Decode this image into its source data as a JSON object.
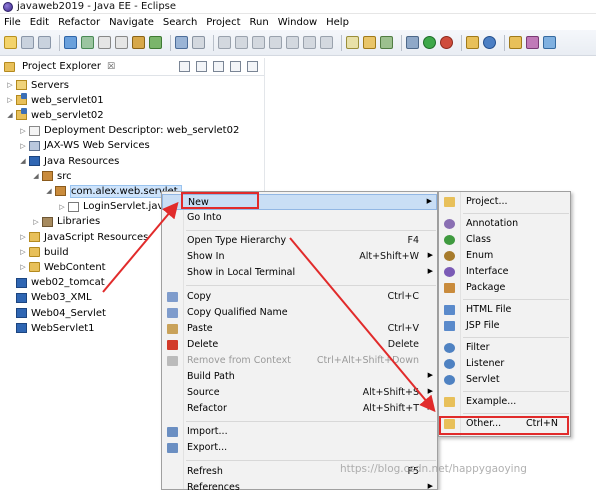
{
  "window": {
    "title": "javaweb2019 - Java EE - Eclipse"
  },
  "menubar": [
    "File",
    "Edit",
    "Refactor",
    "Navigate",
    "Search",
    "Project",
    "Run",
    "Window",
    "Help"
  ],
  "explorer": {
    "tab_label": "Project Explorer",
    "tab_close": "☒",
    "tree": [
      {
        "label": "Servers",
        "depth": 0,
        "expander": "▷",
        "icon": "servers-icon"
      },
      {
        "label": "web_servlet01",
        "depth": 0,
        "expander": "▷",
        "icon": "project-icon"
      },
      {
        "label": "web_servlet02",
        "depth": 0,
        "expander": "◢",
        "icon": "project-icon"
      },
      {
        "label": "Deployment Descriptor: web_servlet02",
        "depth": 1,
        "expander": "▷",
        "icon": "deployment-descriptor-icon"
      },
      {
        "label": "JAX-WS Web Services",
        "depth": 1,
        "expander": "▷",
        "icon": "web-services-icon"
      },
      {
        "label": "Java Resources",
        "depth": 1,
        "expander": "◢",
        "icon": "java-resources-icon"
      },
      {
        "label": "src",
        "depth": 2,
        "expander": "◢",
        "icon": "source-folder-icon"
      },
      {
        "label": "com.alex.web.servlet",
        "depth": 3,
        "expander": "◢",
        "icon": "package-icon",
        "selected": true
      },
      {
        "label": "LoginServlet.java",
        "depth": 4,
        "expander": "▷",
        "icon": "java-file-icon"
      },
      {
        "label": "Libraries",
        "depth": 2,
        "expander": "▷",
        "icon": "library-icon"
      },
      {
        "label": "JavaScript Resources",
        "depth": 1,
        "expander": "▷",
        "icon": "javascript-resources-icon"
      },
      {
        "label": "build",
        "depth": 1,
        "expander": "▷",
        "icon": "folder-icon"
      },
      {
        "label": "WebContent",
        "depth": 1,
        "expander": "▷",
        "icon": "folder-icon"
      },
      {
        "label": "web02_tomcat",
        "depth": 0,
        "expander": "",
        "icon": "closed-project-icon"
      },
      {
        "label": "Web03_XML",
        "depth": 0,
        "expander": "",
        "icon": "closed-project-icon"
      },
      {
        "label": "Web04_Servlet",
        "depth": 0,
        "expander": "",
        "icon": "closed-project-icon"
      },
      {
        "label": "WebServlet1",
        "depth": 0,
        "expander": "",
        "icon": "closed-project-icon"
      }
    ]
  },
  "context_menu": {
    "items": [
      {
        "label": "New",
        "shortcut": "",
        "submenu": true,
        "icon": "",
        "highlighted": true
      },
      {
        "label": "Go Into",
        "shortcut": "",
        "icon": ""
      },
      {
        "sep": true
      },
      {
        "label": "Open Type Hierarchy",
        "shortcut": "F4",
        "icon": ""
      },
      {
        "label": "Show In",
        "shortcut": "Alt+Shift+W",
        "submenu": true,
        "icon": ""
      },
      {
        "label": "Show in Local Terminal",
        "shortcut": "",
        "submenu": true,
        "icon": ""
      },
      {
        "sep": true
      },
      {
        "label": "Copy",
        "shortcut": "Ctrl+C",
        "icon": "copy-icon"
      },
      {
        "label": "Copy Qualified Name",
        "shortcut": "",
        "icon": "copy-qualified-name-icon"
      },
      {
        "label": "Paste",
        "shortcut": "Ctrl+V",
        "icon": "paste-icon"
      },
      {
        "label": "Delete",
        "shortcut": "Delete",
        "icon": "delete-icon"
      },
      {
        "label": "Remove from Context",
        "shortcut": "Ctrl+Alt+Shift+Down",
        "icon": "remove-from-context-icon",
        "disabled": true
      },
      {
        "label": "Build Path",
        "shortcut": "",
        "submenu": true,
        "icon": ""
      },
      {
        "label": "Source",
        "shortcut": "Alt+Shift+S",
        "submenu": true,
        "icon": ""
      },
      {
        "label": "Refactor",
        "shortcut": "Alt+Shift+T",
        "submenu": true,
        "icon": ""
      },
      {
        "sep": true
      },
      {
        "label": "Import...",
        "shortcut": "",
        "icon": "import-icon"
      },
      {
        "label": "Export...",
        "shortcut": "",
        "icon": "export-icon"
      },
      {
        "sep": true
      },
      {
        "label": "Refresh",
        "shortcut": "F5",
        "icon": ""
      },
      {
        "label": "References",
        "shortcut": "",
        "submenu": true,
        "icon": ""
      }
    ]
  },
  "new_submenu": {
    "items": [
      {
        "label": "Project...",
        "shortcut": "",
        "icon": "new-project-icon"
      },
      {
        "sep": true
      },
      {
        "label": "Annotation",
        "shortcut": "",
        "icon": "annotation-icon"
      },
      {
        "label": "Class",
        "shortcut": "",
        "icon": "class-icon"
      },
      {
        "label": "Enum",
        "shortcut": "",
        "icon": "enum-icon"
      },
      {
        "label": "Interface",
        "shortcut": "",
        "icon": "interface-icon"
      },
      {
        "label": "Package",
        "shortcut": "",
        "icon": "package-icon"
      },
      {
        "sep": true
      },
      {
        "label": "HTML File",
        "shortcut": "",
        "icon": "html-file-icon"
      },
      {
        "label": "JSP File",
        "shortcut": "",
        "icon": "jsp-file-icon"
      },
      {
        "sep": true
      },
      {
        "label": "Filter",
        "shortcut": "",
        "icon": "filter-icon"
      },
      {
        "label": "Listener",
        "shortcut": "",
        "icon": "listener-icon"
      },
      {
        "label": "Servlet",
        "shortcut": "",
        "icon": "servlet-icon"
      },
      {
        "sep": true
      },
      {
        "label": "Example...",
        "shortcut": "",
        "icon": "example-icon"
      },
      {
        "sep": true
      },
      {
        "label": "Other...",
        "shortcut": "Ctrl+N",
        "icon": "other-wizard-icon"
      }
    ]
  },
  "watermark": "https://blog.csdn.net/happygaoying",
  "colors": {
    "annotation_box": "#e12b2b",
    "selection": "#cde3fb",
    "menu_bg": "#f2f2f2"
  }
}
